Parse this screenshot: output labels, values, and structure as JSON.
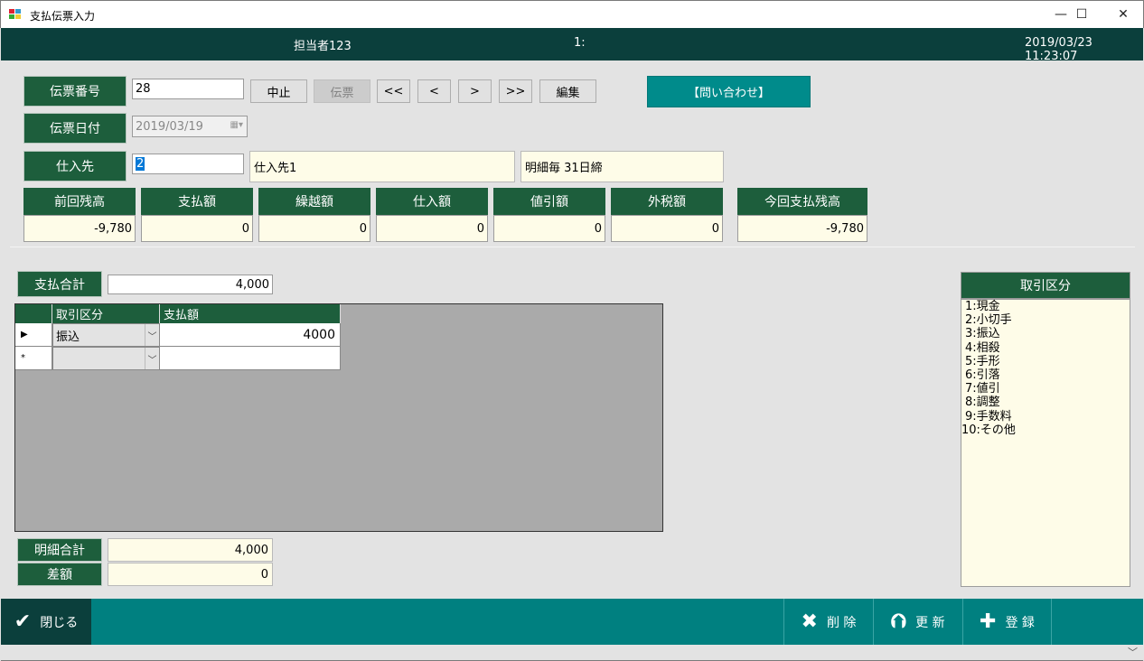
{
  "window": {
    "title": "支払伝票入力",
    "minimize": "—",
    "maximize": "☐",
    "close": "✕"
  },
  "header": {
    "staff": "担当者123",
    "mode": "1:",
    "datetime": "2019/03/23 11:23:07"
  },
  "form": {
    "slip_no_label": "伝票番号",
    "slip_no_value": "28",
    "slip_date_label": "伝票日付",
    "slip_date_value": "2019/03/19",
    "supplier_label": "仕入先",
    "supplier_code": "2",
    "supplier_name": "仕入先1",
    "supplier_terms": "明細毎 31日締"
  },
  "toolbar": {
    "cancel": "中止",
    "slip": "伝票",
    "first": "<<",
    "prev": "<",
    "next": ">",
    "last": ">>",
    "edit": "編集",
    "inquiry": "【問い合わせ】"
  },
  "summary": [
    {
      "label": "前回残高",
      "value": "-9,780"
    },
    {
      "label": "支払額",
      "value": "0"
    },
    {
      "label": "繰越額",
      "value": "0"
    },
    {
      "label": "仕入額",
      "value": "0"
    },
    {
      "label": "値引額",
      "value": "0"
    },
    {
      "label": "外税額",
      "value": "0"
    },
    {
      "label": "今回支払残高",
      "value": "-9,780"
    }
  ],
  "payment_total": {
    "label": "支払合計",
    "value": "4,000"
  },
  "grid": {
    "columns": [
      "取引区分",
      "支払額"
    ],
    "rows": [
      {
        "marker": "▶",
        "type": "振込",
        "amount": "4000"
      },
      {
        "marker": "*",
        "type": "",
        "amount": ""
      }
    ]
  },
  "detail_total": {
    "label": "明細合計",
    "value": "4,000"
  },
  "difference": {
    "label": "差額",
    "value": "0"
  },
  "legend": {
    "title": "取引区分",
    "items": [
      "1:現金",
      "2:小切手",
      "3:振込",
      "4:相殺",
      "5:手形",
      "6:引落",
      "7:値引",
      "8:調整",
      "9:手数料",
      "10:その他"
    ]
  },
  "footer": {
    "close": "閉じる",
    "delete": "削 除",
    "update": "更 新",
    "register": "登 録"
  },
  "colors": {
    "header_bg": "#0b3f3c",
    "label_green": "#1d5e3c",
    "teal": "#008b8b",
    "readonly_bg": "#fefce8"
  }
}
